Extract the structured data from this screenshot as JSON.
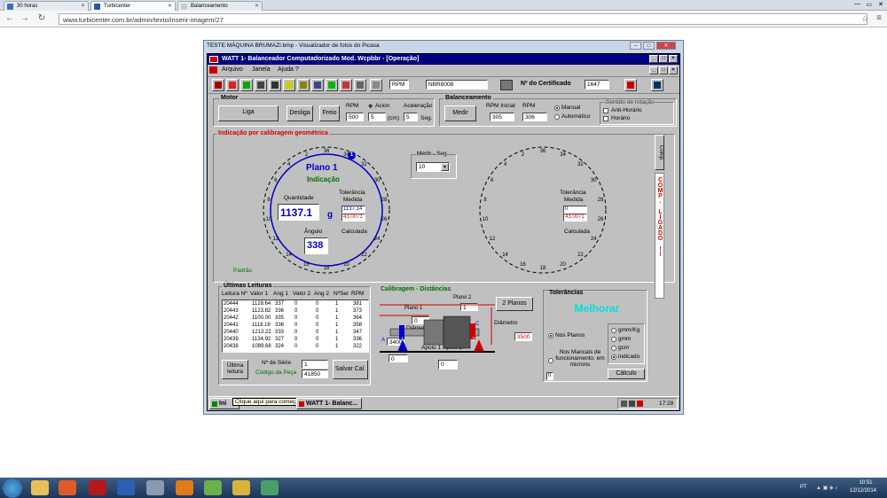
{
  "browser": {
    "tabs": [
      {
        "label": "30 horas"
      },
      {
        "label": "Turbicenter"
      },
      {
        "label": "Balanceamento"
      }
    ],
    "url": "www.turbicenter.com.br/admin/texto/inserir-imagem/27"
  },
  "picasa": {
    "title": "TESTE MÁQUINA BRUMAZI.bmp - Visualizador de fotos do Picasa"
  },
  "app": {
    "title": "WATT 1- Balanceador Computadorizado  Mod. Wcpbbr - [Operação]",
    "menu": [
      "Arquivo",
      "Janela",
      "Ajuda ?"
    ],
    "rpm_label": "RPM",
    "norm_value": "NBR8008",
    "cert_label": "Nº do Certificado",
    "cert_value": "1647",
    "motor": {
      "label": "Motor",
      "liga": "Liga",
      "desliga": "Desliga",
      "freio": "Freio",
      "rpm_label": "RPM",
      "rpm_value": "500",
      "acion_label": "Acion",
      "acion_value": "5",
      "acion_unit": "(cm)",
      "acel_label": "Aceleração",
      "acel_value": "5",
      "acel_unit": "Seg."
    },
    "balance": {
      "label": "Balanceamento",
      "medir": "Medir",
      "rpm_ini_label": "RPM Inicial",
      "rpm_ini_value": "305",
      "rpm_label": "RPM",
      "rpm_value": "306",
      "manual": "Manual",
      "automatico": "Automático",
      "rot_label": "Sentido de rotação",
      "anti": "Anti-Horário",
      "horario": "Horário"
    },
    "indic": {
      "label": "Indicação por calibragem geométrica",
      "medir_seg_label": "Medir - Seg.",
      "medir_seg_value": "10",
      "padrao": "Padrão",
      "comp_btn": "Comp.",
      "comp_ligado": "COMP. LIGADO !!"
    },
    "dial_numbers": [
      "36",
      "34",
      "32",
      "30",
      "28",
      "26",
      "24",
      "22",
      "20",
      "18",
      "16",
      "14",
      "12",
      "10",
      "8",
      "6",
      "4",
      "2"
    ],
    "plane1": {
      "title": "Plano 1",
      "subtitle": "Indicação",
      "marker": "1",
      "qty_label": "Quantidade",
      "qty_value": "1137.1",
      "qty_unit": "g",
      "angle_label": "Ângulo",
      "angle_value": "338",
      "tol_label": "Tolerância",
      "medida_label": "Medida",
      "tol_value": "1137.14",
      "calc_value": "43.0071",
      "calc_label": "Calculada"
    },
    "plane2": {
      "tol_label": "Tolerância",
      "medida_label": "Medida",
      "tol_value": "0",
      "calc_value": "43.0071",
      "calc_label": "Calculada"
    },
    "readings": {
      "label": "Últimas Leituras",
      "headers": [
        "Leitura Nº",
        "Valor 1",
        "Ang 1",
        "Valor 2",
        "Ang 2",
        "NºSer",
        "RPM"
      ],
      "rows": [
        [
          "20444",
          "1128.64",
          "337",
          "0",
          "0",
          "1",
          "381"
        ],
        [
          "20443",
          "1123.82",
          "336",
          "0",
          "0",
          "1",
          "373"
        ],
        [
          "20442",
          "1100.00",
          "335",
          "0",
          "0",
          "1",
          "364"
        ],
        [
          "20441",
          "1118.16",
          "336",
          "0",
          "0",
          "1",
          "358"
        ],
        [
          "20440",
          "1213.22",
          "333",
          "0",
          "0",
          "1",
          "347"
        ],
        [
          "20439",
          "1134.92",
          "327",
          "0",
          "0",
          "1",
          "336"
        ],
        [
          "20438",
          "1089.68",
          "324",
          "0",
          "0",
          "1",
          "322"
        ]
      ],
      "ultima": "Última leitura",
      "serie_label": "Nº de Série",
      "serie_value": "1",
      "cod_label": "Código da Peça",
      "cod_value": "41850",
      "salvar": "Salvar Cal."
    },
    "calib": {
      "label": "Calibragem - Distâncias",
      "planos_btn": "2 Planos",
      "plano1": "Plano 1",
      "plano2": "Plano 2",
      "plano2_value": "1",
      "plano1_value": "0",
      "diam_label": "Diâmetro",
      "diam_value": "3500",
      "diam1_label": "Diâmetro1 (mm)",
      "diam1_value": "3400",
      "apoio1": "Apoio 1",
      "apoio2": "Apoio 2",
      "apoio_value": "0",
      "bottom_value": "0",
      "mark_a": "A",
      "mark_b": "B",
      "mark_c": "C",
      "mark_1": "1",
      "mark_2": "2"
    },
    "tol": {
      "label": "Tolerâncias",
      "status": "Melhorar",
      "nos_planos": "Nos Planos",
      "nos_mancais": "Nos Mancais de funcionamento, em microns",
      "mancais_value": "0",
      "units": [
        "gmm/Kg",
        "gmm",
        "gcm",
        "indicado"
      ],
      "calculo": "Cálculo"
    },
    "taskbar": {
      "start": "Iní",
      "tooltip": "Clique aqui para começar.",
      "task": "WATT 1- Balanc...",
      "time": "17:28"
    }
  },
  "os": {
    "lang": "PT",
    "time": "10:51",
    "date": "12/12/2014"
  },
  "colors": {
    "dial_blue": "#0000c8",
    "accent_red": "#d00000",
    "melhorar": "#00e0e0",
    "green": "#007000"
  }
}
